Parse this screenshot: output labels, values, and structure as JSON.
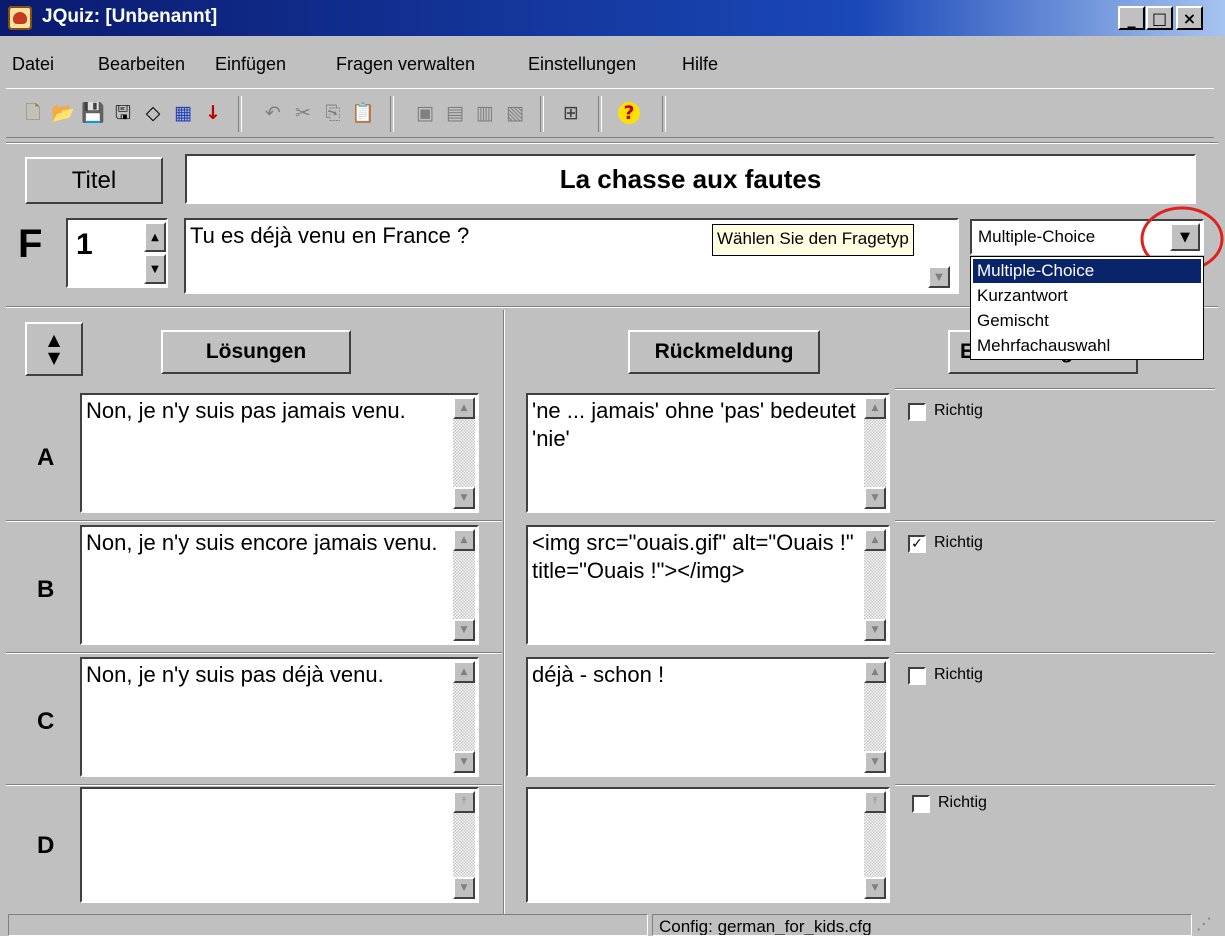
{
  "window": {
    "title": "JQuiz: [Unbenannt]",
    "min_glyph": "_",
    "max_glyph": "□",
    "close_glyph": "×"
  },
  "menu": [
    "Datei",
    "Bearbeiten",
    "Einfügen",
    "Fragen verwalten",
    "Einstellungen",
    "Hilfe"
  ],
  "toolbar": {
    "icons": [
      "new-file-icon",
      "open-folder-icon",
      "save-icon",
      "save-as-icon",
      "eraser-icon",
      "web-export-icon",
      "arrow-down-icon",
      "undo-icon",
      "cut-icon",
      "copy-icon",
      "paste-icon",
      "question-tool-1-icon",
      "question-tool-2-icon",
      "question-tool-3-icon",
      "question-tool-4-icon",
      "colors-icon",
      "help-icon"
    ],
    "glyphs": [
      "🗋",
      "📂",
      "💾",
      "🖫",
      "◇",
      "▦",
      "↓",
      "↶",
      "✂",
      "⎘",
      "📋",
      "▣",
      "▤",
      "▥",
      "▧",
      "⊞",
      "?"
    ]
  },
  "header": {
    "title_button": "Titel",
    "quiz_title": "La chasse aux fautes",
    "question_label": "F",
    "question_number": "1",
    "question_text": "Tu es déjà venu en France ?",
    "tooltip": "Wählen Sie den Fragetyp",
    "question_type": {
      "selected": "Multiple-Choice",
      "options": [
        "Multiple-Choice",
        "Kurzantwort",
        "Gemischt",
        "Mehrfachauswahl"
      ]
    }
  },
  "answers_panel": {
    "solutions_button": "Lösungen",
    "feedback_button": "Rückmeldung",
    "settings_button_partial": "Einstellungen",
    "rows": [
      {
        "label": "A",
        "answer": "Non, je n'y suis pas jamais venu.",
        "feedback": "'ne ... jamais' ohne 'pas' bedeutet 'nie'",
        "correct_label": "Richtig",
        "correct": false
      },
      {
        "label": "B",
        "answer": "Non, je n'y suis encore jamais venu.",
        "feedback": "<img src=\"ouais.gif\" alt=\"Ouais !\" title=\"Ouais !\"></img>",
        "correct_label": "Richtig",
        "correct": true
      },
      {
        "label": "C",
        "answer": "Non, je n'y suis pas déjà venu.",
        "feedback": "déjà - schon !",
        "correct_label": "Richtig",
        "correct": false
      },
      {
        "label": "D",
        "answer": "",
        "feedback": "",
        "correct_label": "Richtig",
        "correct": false
      }
    ]
  },
  "status": {
    "config": "Config: german_for_kids.cfg"
  },
  "colors": {
    "titlebar_start": "#0a1a6e",
    "highlight": "#0a246a",
    "annotation_circle": "#e02020"
  }
}
